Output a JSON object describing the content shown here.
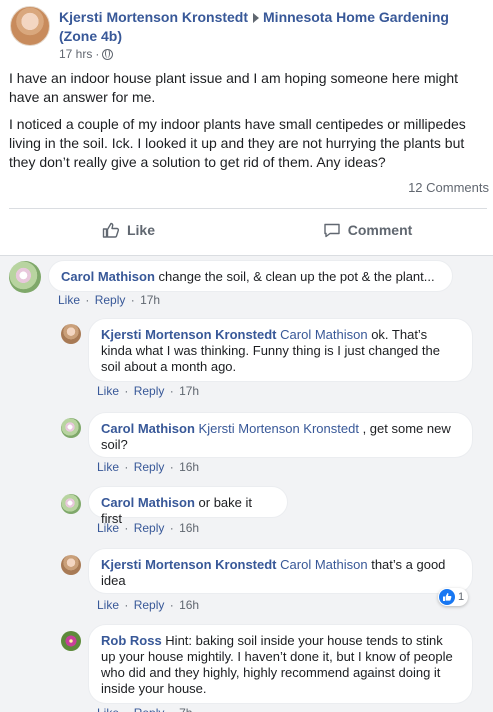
{
  "post": {
    "author": "Kjersti Mortenson Kronstedt",
    "group": "Minnesota Home Gardening (Zone 4b)",
    "time": "17 hrs",
    "paragraphs": [
      "I have an indoor house plant issue and I am hoping someone here might have an answer for me.",
      "I noticed a couple of my indoor plants have small centipedes or millipedes living in the soil. Ick. I looked it up and they are not hurrying the plants but they don’t really give a solution to get rid of them. Any ideas?"
    ],
    "comment_count": "12 Comments"
  },
  "actions": {
    "like": "Like",
    "comment": "Comment"
  },
  "labels": {
    "like": "Like",
    "reply": "Reply",
    "sep": "·"
  },
  "comments": [
    {
      "author": "Carol Mathison",
      "mention": "",
      "text": "change the soil, & clean up the pot & the plant...",
      "time": "17h"
    },
    {
      "author": "Kjersti Mortenson Kronstedt",
      "mention": "Carol Mathison",
      "text": "ok. That’s kinda what I was thinking. Funny thing is I just changed the soil about a month ago.",
      "time": "17h"
    },
    {
      "author": "Carol Mathison",
      "mention": "Kjersti Mortenson Kronstedt",
      "text": ", get some new soil?",
      "time": "16h"
    },
    {
      "author": "Carol Mathison",
      "mention": "",
      "text": "or bake it first",
      "time": "16h"
    },
    {
      "author": "Kjersti Mortenson Kronstedt",
      "mention": "Carol Mathison",
      "text": "that’s a good idea",
      "time": "16h",
      "reactions": "1"
    },
    {
      "author": "Rob Ross",
      "mention": "",
      "text": "Hint: baking soil inside your house tends to stink up your house mightily. I haven’t done it, but I know of people who did and they highly, highly recommend against doing it inside your house.",
      "time": "7h"
    }
  ],
  "colors": {
    "link": "#385898",
    "muted": "#606770",
    "reaction": "#1877f2"
  }
}
